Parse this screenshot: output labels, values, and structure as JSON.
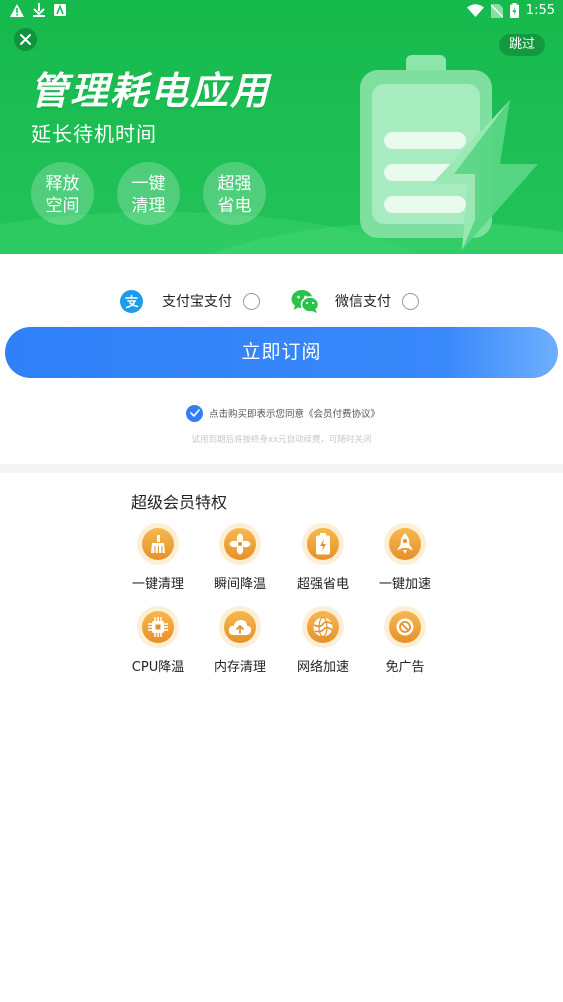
{
  "status_bar": {
    "time": "1:55"
  },
  "banner": {
    "close_icon": "close-icon",
    "skip_label": "跳过",
    "title": "管理耗电应用",
    "subtitle": "延长待机时间",
    "features": [
      {
        "line1": "释放",
        "line2": "空间"
      },
      {
        "line1": "一键",
        "line2": "清理"
      },
      {
        "line1": "超强",
        "line2": "省电"
      }
    ],
    "colors": {
      "green": "#16b94c",
      "hill": "#3fd673"
    }
  },
  "payment": {
    "options": [
      {
        "label": "支付宝支付",
        "icon": "alipay-icon",
        "selected": false
      },
      {
        "label": "微信支付",
        "icon": "wechat-icon",
        "selected": false
      }
    ],
    "subscribe_label": "立即订阅",
    "agreement_text": "点击购买即表示您同意《会员付费协议》",
    "agreement_checked": true,
    "trial_note": "试用到期后将按终身xx元自动续费，可随时关闭",
    "colors": {
      "primary": "#2f7ff7"
    }
  },
  "privileges": {
    "title": "超级会员特权",
    "items": [
      {
        "label": "一键清理",
        "icon": "broom-icon"
      },
      {
        "label": "瞬间降温",
        "icon": "fan-icon"
      },
      {
        "label": "超强省电",
        "icon": "battery-icon"
      },
      {
        "label": "一键加速",
        "icon": "rocket-icon"
      },
      {
        "label": "CPU降温",
        "icon": "cpu-chip-icon"
      },
      {
        "label": "内存清理",
        "icon": "cloud-upload-icon"
      },
      {
        "label": "网络加速",
        "icon": "globe-icon"
      },
      {
        "label": "免广告",
        "icon": "no-ads-icon"
      }
    ],
    "colors": {
      "icon_bg": "#fdeed6",
      "icon_fill": "#e7902a"
    }
  }
}
